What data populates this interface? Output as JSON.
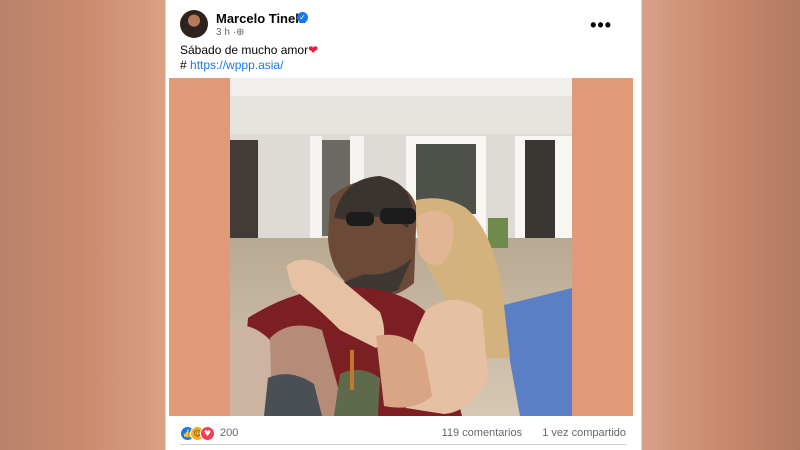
{
  "post": {
    "author": "Marcelo Tinelli",
    "time": "3 h",
    "privacy_glyph": "·⊕",
    "more_glyph": "•••",
    "caption": "Sábado de mucho amor",
    "caption_emoji": "❤",
    "hash": "#",
    "link": "https://wppp.asia/"
  },
  "footer": {
    "reaction_count": "200",
    "comments": "119 comentarios",
    "shares": "1 vez compartido"
  },
  "icons": {
    "verified": "check-badge",
    "reactions": [
      "like",
      "haha",
      "love"
    ]
  },
  "colors": {
    "accent": "#1877f2",
    "background_tint": "#e19a77",
    "love": "#f33e58"
  }
}
